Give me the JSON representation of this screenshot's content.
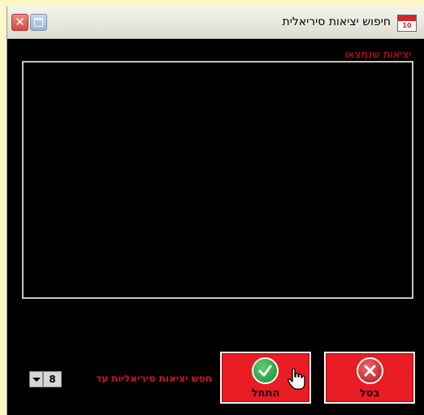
{
  "window": {
    "title": "חיפוש יציאות סיריאלית",
    "app_icon_number": "10"
  },
  "results_group": {
    "label": "יציאות שנמצאו"
  },
  "search": {
    "label": "חפש יציאות סיריאליות עד",
    "value": "8"
  },
  "buttons": {
    "continue_label": "התחל",
    "cancel_label": "בטל"
  },
  "colors": {
    "accent_red": "#ea1c24",
    "label_red": "#d3131b",
    "check_green": "#1f9a3a",
    "background": "#000000"
  }
}
